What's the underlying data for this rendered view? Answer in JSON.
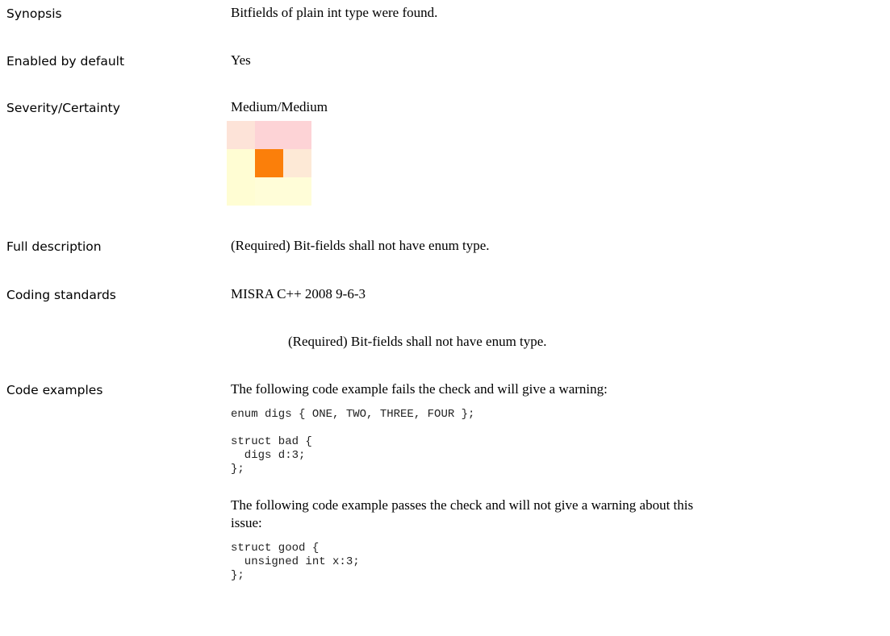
{
  "rows": {
    "synopsis": {
      "label": "Synopsis",
      "value": "Bitfields of plain int type were found."
    },
    "enabled": {
      "label": "Enabled by default",
      "value": "Yes"
    },
    "severity": {
      "label": "Severity/Certainty",
      "value": "Medium/Medium",
      "matrix_colors": [
        [
          "#fde3d8",
          "#fdd3d6",
          "#fdd3d6"
        ],
        [
          "#fffdd3",
          "#fb7f0a",
          "#fde9d6"
        ],
        [
          "#fffdd3",
          "#fffdd8",
          "#fffdd8"
        ]
      ]
    },
    "full_description": {
      "label": "Full description",
      "value": "(Required) Bit-fields shall not have enum type."
    },
    "coding_standards": {
      "label": "Coding standards",
      "value": "MISRA C++ 2008 9-6-3",
      "detail": "(Required) Bit-fields shall not have enum type."
    },
    "code_examples": {
      "label": "Code examples",
      "fail_intro": "The following code example fails the check and will give a warning:",
      "fail_code_1": "enum digs { ONE, TWO, THREE, FOUR };",
      "fail_code_2": "struct bad {\n  digs d:3;\n};",
      "pass_intro_1": "The following code example passes the check and will not give a warning about this",
      "pass_intro_2": "issue:",
      "pass_code": "struct good {\n  unsigned int x:3;\n};"
    }
  }
}
